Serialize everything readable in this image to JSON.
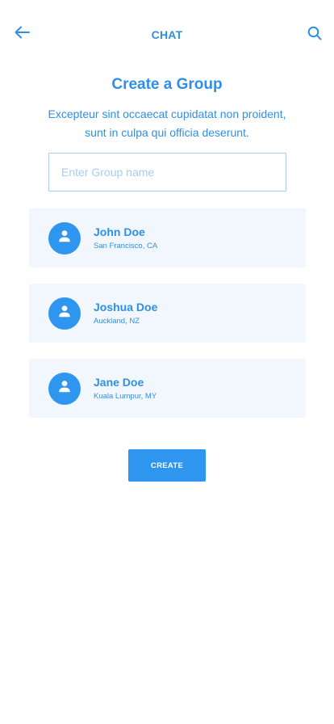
{
  "header": {
    "title": "CHAT",
    "back_icon": "arrow-left-icon",
    "search_icon": "search-icon"
  },
  "page": {
    "title": "Create a Group",
    "subtitle": "Excepteur sint occaecat cupidatat non proident, sunt in culpa qui officia deserunt."
  },
  "group_name_input": {
    "placeholder": "Enter Group name",
    "value": ""
  },
  "members": [
    {
      "name": "John Doe",
      "location": "San Francisco, CA",
      "avatar_icon": "user-icon"
    },
    {
      "name": "Joshua Doe",
      "location": "Auckland, NZ",
      "avatar_icon": "user-icon"
    },
    {
      "name": "Jane Doe",
      "location": "Kuala Lumpur, MY",
      "avatar_icon": "user-icon"
    }
  ],
  "create_button": {
    "label": "CREATE"
  },
  "colors": {
    "primary": "#2f96f0",
    "text": "#2f8fe6",
    "card_background": "#f1f7fd",
    "input_border": "#a8cdf2",
    "placeholder": "#a7cdf2"
  }
}
